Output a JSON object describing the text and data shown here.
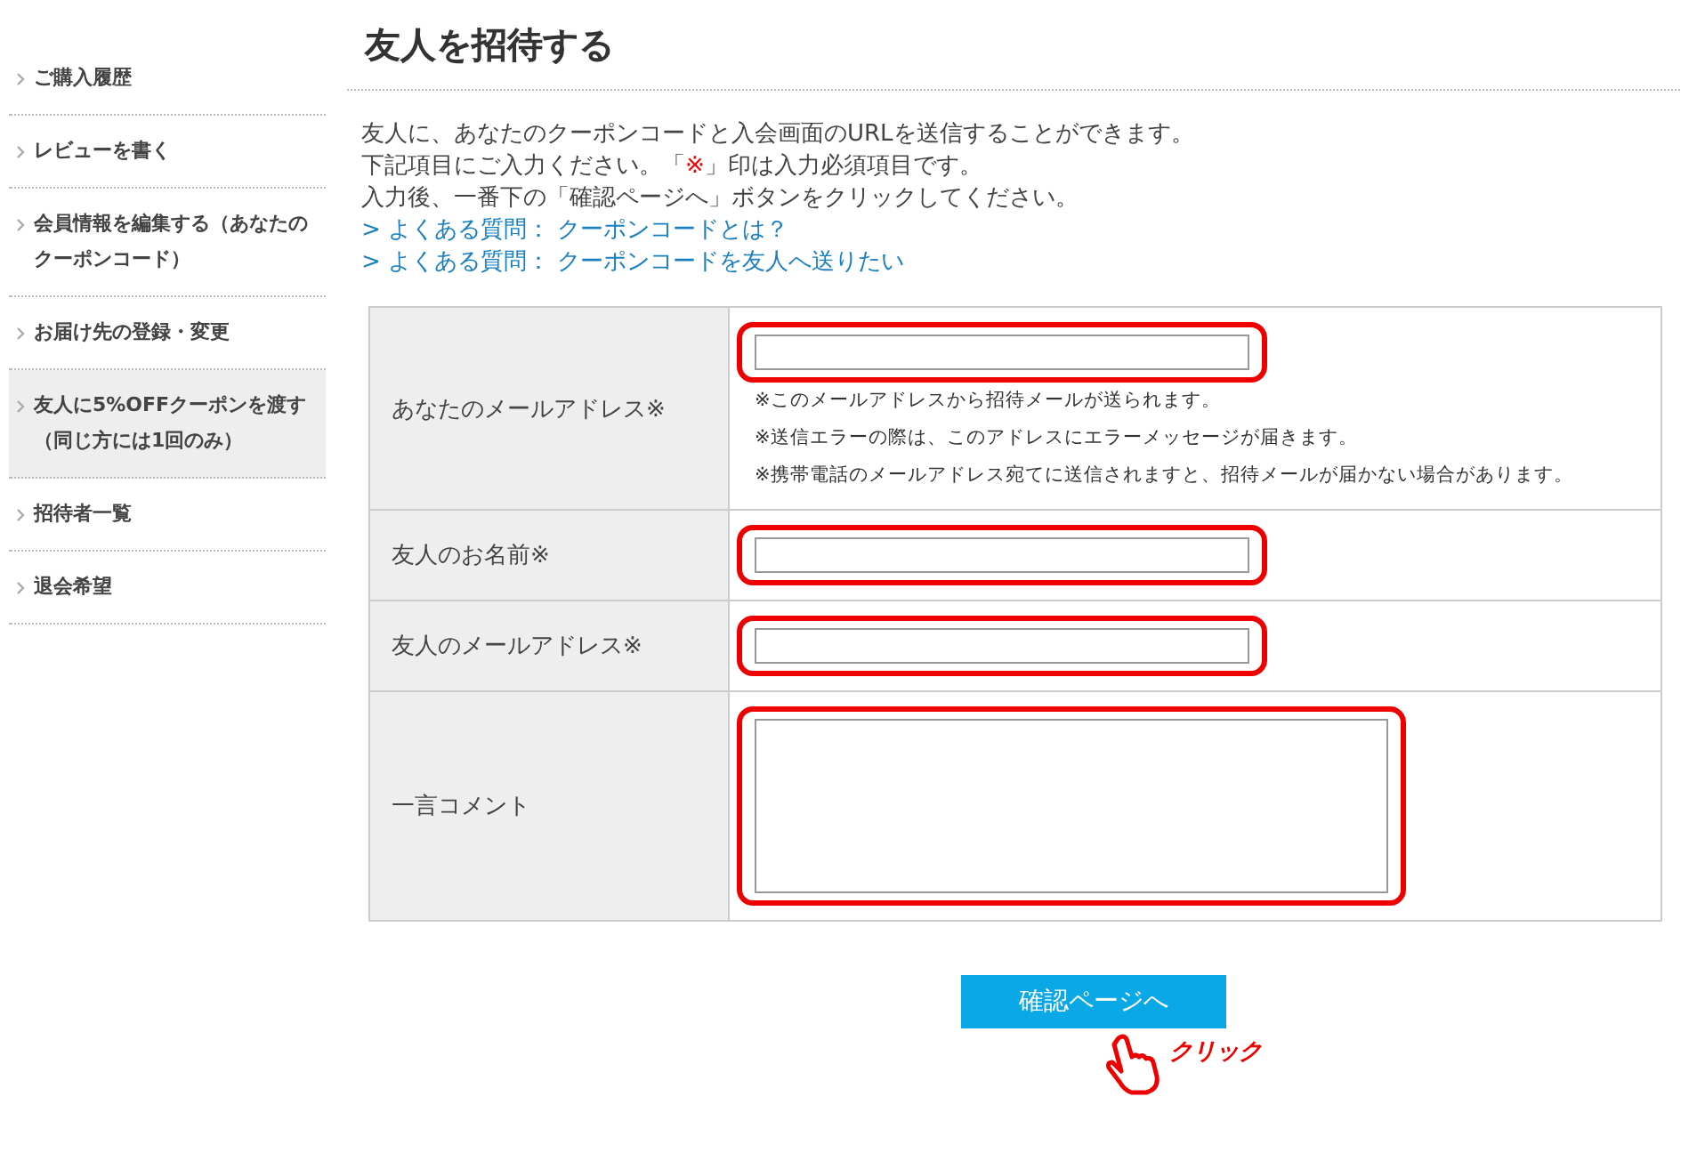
{
  "sidebar": {
    "items": [
      {
        "label": "ご購入履歴",
        "selected": false
      },
      {
        "label": "レビューを書く",
        "selected": false
      },
      {
        "label": "会員情報を編集する（あなたのクーポンコード）",
        "selected": false
      },
      {
        "label": "お届け先の登録・変更",
        "selected": false
      },
      {
        "label": "友人に5%OFFクーポンを渡す（同じ方には1回のみ）",
        "selected": true
      },
      {
        "label": "招待者一覧",
        "selected": false
      },
      {
        "label": "退会希望",
        "selected": false
      }
    ]
  },
  "page": {
    "title": "友人を招待する",
    "intro": [
      {
        "kind": "text",
        "text": "友人に、あなたのクーポンコードと入会画面のURLを送信することができます。"
      },
      {
        "kind": "required_note",
        "before": "下記項目にご入力ください。「",
        "mark": "※",
        "after": "」印は入力必須項目です。"
      },
      {
        "kind": "text",
        "text": "入力後、一番下の「確認ページへ」ボタンをクリックしてください。"
      }
    ],
    "links": [
      "> よくある質問： クーポンコードとは？",
      "> よくある質問： クーポンコードを友人へ送りたい"
    ]
  },
  "form": {
    "rows": [
      {
        "label": "あなたのメールアドレス※",
        "kind": "input",
        "highlighted": true,
        "notes": [
          "※このメールアドレスから招待メールが送られます。",
          "※送信エラーの際は、このアドレスにエラーメッセージが届きます。",
          "※携帯電話のメールアドレス宛てに送信されますと、招待メールが届かない場合があります。"
        ]
      },
      {
        "label": "友人のお名前※",
        "kind": "input",
        "highlighted": true
      },
      {
        "label": "友人のメールアドレス※",
        "kind": "input",
        "highlighted": true
      },
      {
        "label": "一言コメント",
        "kind": "textarea",
        "highlighted": true
      }
    ]
  },
  "submit": {
    "label": "確認ページへ",
    "callout": "クリック"
  }
}
